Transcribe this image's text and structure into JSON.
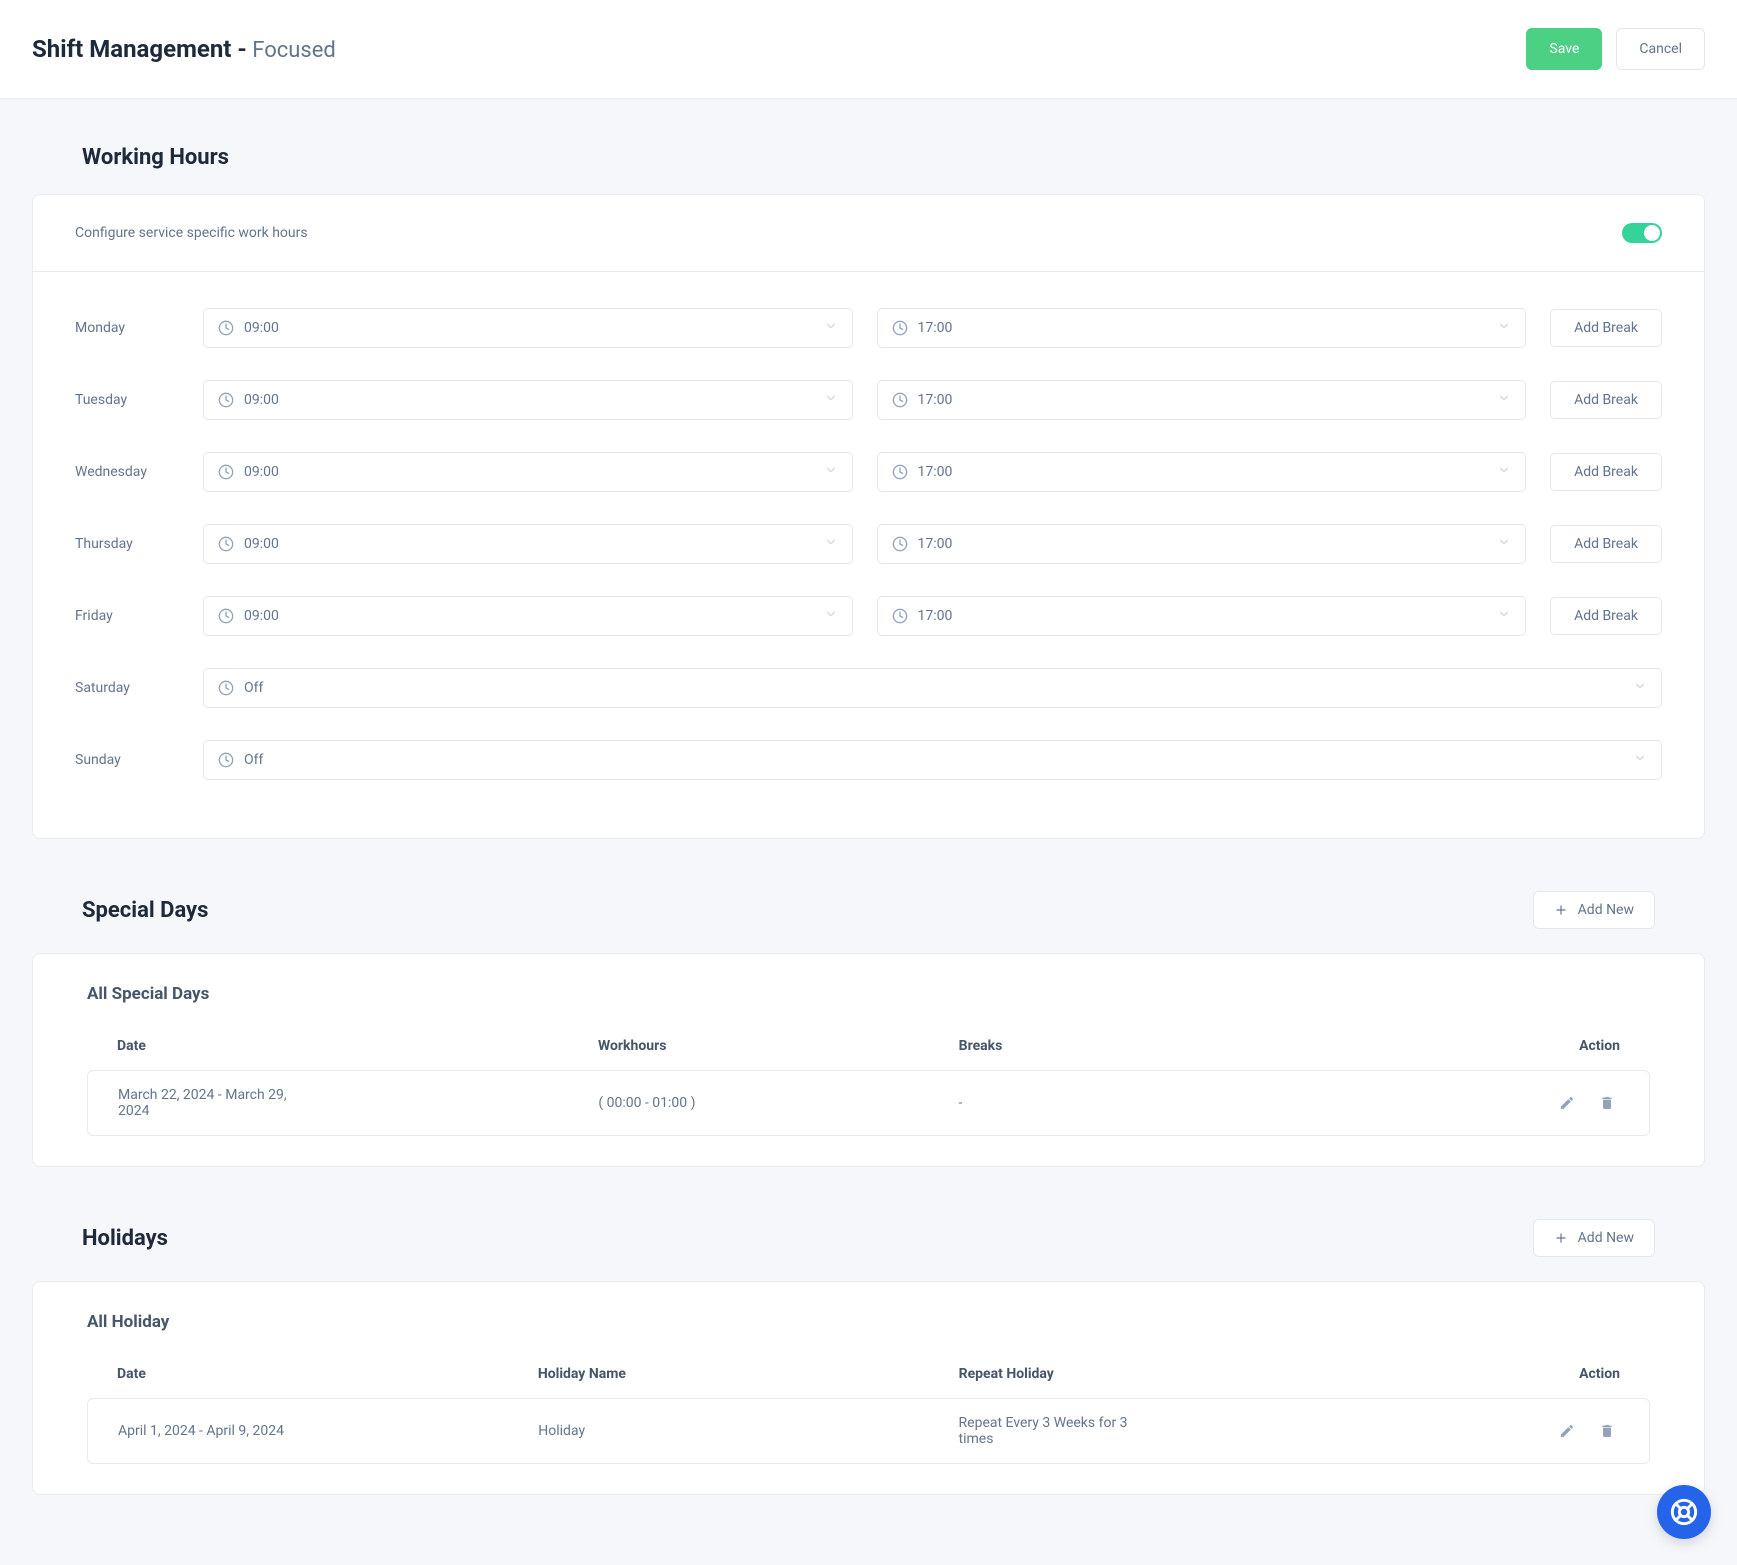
{
  "header": {
    "title_main": "Shift Management -",
    "title_suffix": " Focused",
    "save_label": "Save",
    "cancel_label": "Cancel"
  },
  "working_hours": {
    "section_title": "Working Hours",
    "subtitle": "Configure service specific work hours",
    "toggle_on": true,
    "add_break_label": "Add Break",
    "days": [
      {
        "name": "Monday",
        "start": "09:00",
        "end": "17:00",
        "off": false
      },
      {
        "name": "Tuesday",
        "start": "09:00",
        "end": "17:00",
        "off": false
      },
      {
        "name": "Wednesday",
        "start": "09:00",
        "end": "17:00",
        "off": false
      },
      {
        "name": "Thursday",
        "start": "09:00",
        "end": "17:00",
        "off": false
      },
      {
        "name": "Friday",
        "start": "09:00",
        "end": "17:00",
        "off": false
      },
      {
        "name": "Saturday",
        "start": "Off",
        "end": "",
        "off": true
      },
      {
        "name": "Sunday",
        "start": "Off",
        "end": "",
        "off": true
      }
    ]
  },
  "special_days": {
    "section_title": "Special Days",
    "add_new_label": "Add New",
    "list_title": "All Special Days",
    "columns": {
      "date": "Date",
      "workhours": "Workhours",
      "breaks": "Breaks",
      "action": "Action"
    },
    "rows": [
      {
        "date": "March 22, 2024 - March 29, 2024",
        "workhours": "( 00:00 - 01:00 )",
        "breaks": "-"
      }
    ]
  },
  "holidays": {
    "section_title": "Holidays",
    "add_new_label": "Add New",
    "list_title": "All Holiday",
    "columns": {
      "date": "Date",
      "name": "Holiday Name",
      "repeat": "Repeat Holiday",
      "action": "Action"
    },
    "rows": [
      {
        "date": "April 1, 2024 - April 9, 2024",
        "name": "Holiday",
        "repeat": "Repeat Every 3 Weeks for 3 times"
      }
    ]
  }
}
